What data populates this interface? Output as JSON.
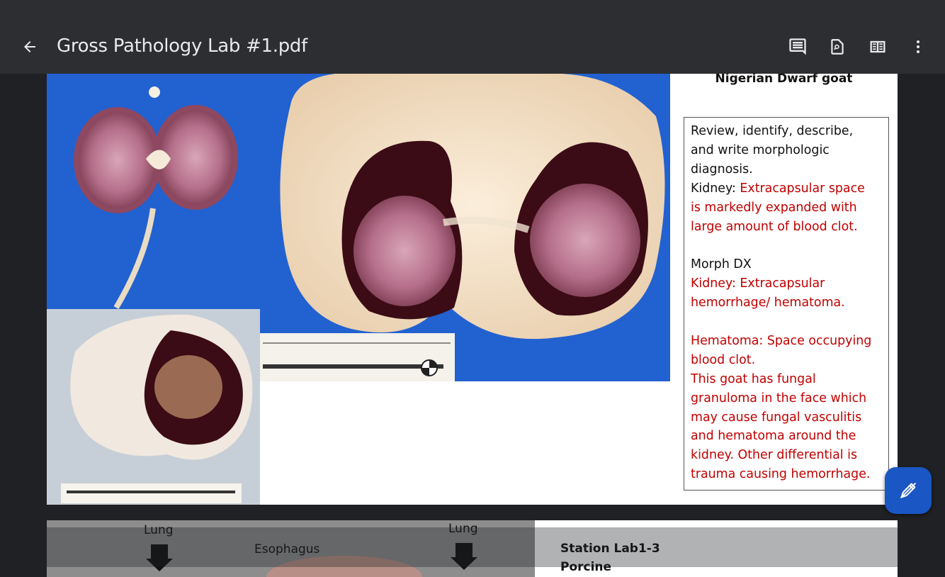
{
  "appbar": {
    "title": "Gross Pathology Lab #1.pdf",
    "icons": [
      "arrow-back-icon",
      "comment-icon",
      "find-in-page-icon",
      "two-page-view-icon",
      "more-vert-icon"
    ]
  },
  "page1": {
    "heading": "Nigerian Dwarf goat",
    "notes": {
      "prompt": [
        "Review, identify, describe,",
        "and write morphologic",
        "diagnosis."
      ],
      "kidney_label": "Kidney: ",
      "kidney_text": [
        "Extracapsular space",
        "is markedly expanded with",
        "large amount of blood clot."
      ],
      "morph_label": "Morph DX",
      "morph_text": [
        "Kidney: Extracapsular",
        "hemorrhage/ hematoma."
      ],
      "hematoma_text": [
        "Hematoma: Space occupying",
        "blood clot.",
        "This goat has fungal",
        "granuloma in the face which",
        "may cause fungal vasculitis",
        "and hematoma around the",
        "kidney. Other differential is",
        "trauma causing hemorrhage."
      ]
    }
  },
  "page2": {
    "label_lung_left": "Lung",
    "label_lung_right": "Lung",
    "label_esophagus": "Esophagus",
    "heading": "Station Lab1-3",
    "subheading": "Porcine"
  },
  "fab": {
    "icon": "edit-pen-icon"
  },
  "colors": {
    "appbar": "#2d2e31",
    "background": "#202124",
    "accent": "#1a56c4",
    "note_red": "#c00000"
  }
}
